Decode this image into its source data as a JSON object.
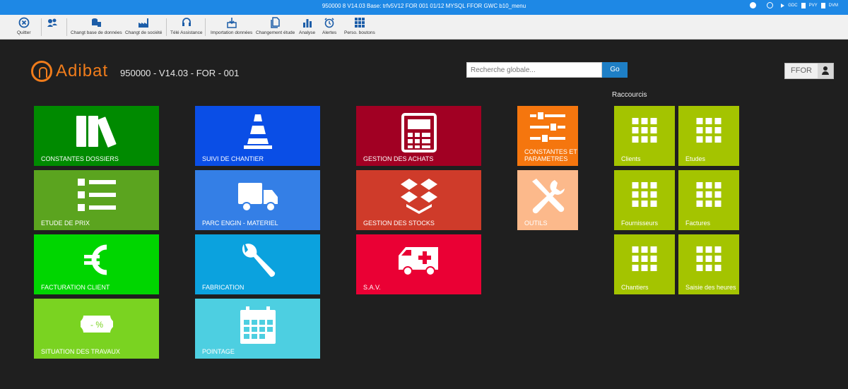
{
  "titlebar": {
    "title": "950000 8 V14.03 Base: trfv5V12 FOR 001 01/12 MYSQL FFOR GWC b10_menu",
    "right_items": [
      "GDC",
      "PVY",
      "DVM"
    ]
  },
  "toolbar": {
    "items": [
      {
        "label": "Quitter",
        "icon": "close-circle-icon"
      },
      {
        "label": "",
        "icon": "users-icon"
      },
      {
        "label": "Changt base de données",
        "icon": "database-icon"
      },
      {
        "label": "Changt de société",
        "icon": "factory-icon"
      },
      {
        "label": "Télé Assistance",
        "icon": "headset-icon"
      },
      {
        "label": "Importation données",
        "icon": "import-icon"
      },
      {
        "label": "Changement étude",
        "icon": "files-icon"
      },
      {
        "label": "Analyse",
        "icon": "bar-chart-icon"
      },
      {
        "label": "Alertes",
        "icon": "alarm-clock-icon"
      },
      {
        "label": "Perso. boutons",
        "icon": "grid-icon"
      }
    ]
  },
  "header": {
    "brand": "Adibat",
    "subtitle": "950000 - V14.03 - FOR - 001",
    "search_placeholder": "Recherche globale...",
    "go_label": "Go",
    "user": "FFOR",
    "shortcuts_title": "Raccourcis"
  },
  "colors": {
    "accent": "#f07c1b",
    "titlebar": "#1e88e5",
    "go_button": "#1e7fc6"
  },
  "tiles": [
    {
      "label": "CONSTANTES DOSSIERS",
      "color": "#008a00",
      "icon": "books-icon"
    },
    {
      "label": "ETUDE DE PRIX",
      "color": "#5ba41f",
      "icon": "list-icon"
    },
    {
      "label": "FACTURATION CLIENT",
      "color": "#00d600",
      "icon": "euro-icon"
    },
    {
      "label": "SITUATION DES TRAVAUX",
      "color": "#7ad321",
      "icon": "ticket-percent-icon",
      "icon_text": "- %"
    },
    {
      "label": "SUIVI DE CHANTIER",
      "color": "#0a4ee6",
      "icon": "traffic-cone-icon"
    },
    {
      "label": "PARC ENGIN - MATERIEL",
      "color": "#347fe6",
      "icon": "truck-icon"
    },
    {
      "label": "FABRICATION",
      "color": "#0ba2de",
      "icon": "wrench-icon"
    },
    {
      "label": "POINTAGE",
      "color": "#4dcfe1",
      "icon": "calendar-icon"
    },
    {
      "label": "GESTION DES ACHATS",
      "color": "#a10023",
      "icon": "calculator-icon"
    },
    {
      "label": "GESTION DES STOCKS",
      "color": "#cf3b2a",
      "icon": "boxes-icon"
    },
    {
      "label": "S.A.V.",
      "color": "#ea0034",
      "icon": "ambulance-icon"
    },
    {
      "label": "CONSTANTES ET PARAMETRES",
      "color": "#f5760e",
      "icon": "sliders-icon"
    },
    {
      "label": "OUTILS",
      "color": "#fcb98b",
      "icon": "tools-icon"
    }
  ],
  "shortcuts": [
    {
      "label": "Clients",
      "color": "#a4c400",
      "icon": "grid-icon"
    },
    {
      "label": "Etudes",
      "color": "#a4c400",
      "icon": "grid-icon"
    },
    {
      "label": "Fournisseurs",
      "color": "#a4c400",
      "icon": "grid-icon"
    },
    {
      "label": "Factures",
      "color": "#a4c400",
      "icon": "grid-icon"
    },
    {
      "label": "Chantiers",
      "color": "#a4c400",
      "icon": "grid-icon"
    },
    {
      "label": "Saisie des heures",
      "color": "#a4c400",
      "icon": "grid-icon"
    }
  ]
}
